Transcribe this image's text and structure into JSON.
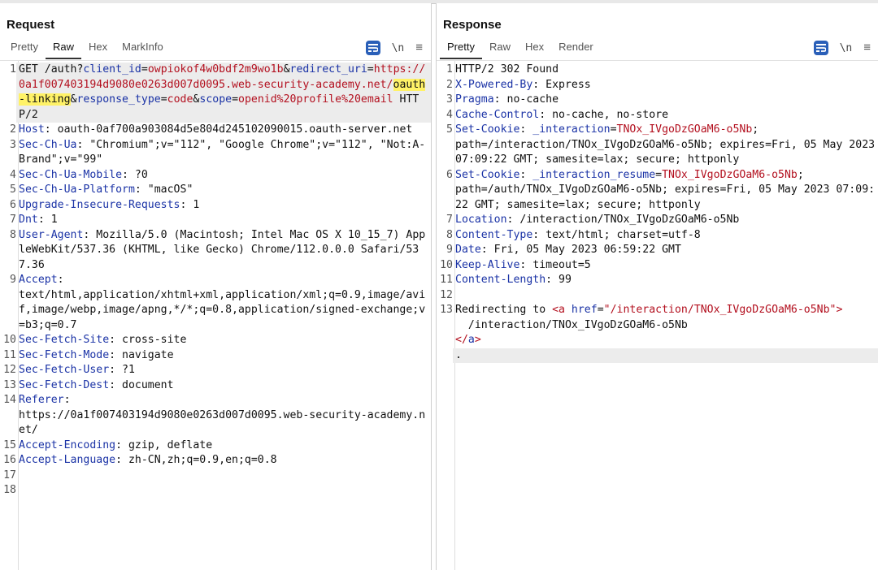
{
  "request": {
    "title": "Request",
    "tabs": [
      "Pretty",
      "Raw",
      "Hex",
      "MarkInfo"
    ],
    "active_tab": "Raw",
    "newline_toggle": "\\n",
    "lines": [
      {
        "n": "1",
        "segs": [
          [
            "t",
            "GET /auth?"
          ],
          [
            "pn",
            "client_id"
          ],
          [
            "t",
            "="
          ],
          [
            "pv",
            "owpiokof4w0bdf2m9wo1b"
          ],
          [
            "t",
            "&"
          ],
          [
            "pn",
            "redirect_uri"
          ],
          [
            "t",
            "="
          ],
          [
            "pv",
            "https://0a1f007403194d9080e0263d007d0095.web-security-academy.net/"
          ],
          [
            "mark",
            "oauth-linking"
          ],
          [
            "t",
            "&"
          ],
          [
            "pn",
            "response_type"
          ],
          [
            "t",
            "="
          ],
          [
            "pv",
            "code"
          ],
          [
            "t",
            "&"
          ],
          [
            "pn",
            "scope"
          ],
          [
            "t",
            "="
          ],
          [
            "pv",
            "openid%20profile%20email"
          ],
          [
            "t",
            " HTTP/2"
          ]
        ],
        "hl": true
      },
      {
        "n": "2",
        "segs": [
          [
            "hk",
            "Host"
          ],
          [
            "t",
            ": oauth-0af700a903084d5e804d245102090015.oauth-server.net"
          ]
        ]
      },
      {
        "n": "3",
        "segs": [
          [
            "hk",
            "Sec-Ch-Ua"
          ],
          [
            "t",
            ": \"Chromium\";v=\"112\", \"Google Chrome\";v=\"112\", \"Not:A-Brand\";v=\"99\""
          ]
        ]
      },
      {
        "n": "4",
        "segs": [
          [
            "hk",
            "Sec-Ch-Ua-Mobile"
          ],
          [
            "t",
            ": ?0"
          ]
        ]
      },
      {
        "n": "5",
        "segs": [
          [
            "hk",
            "Sec-Ch-Ua-Platform"
          ],
          [
            "t",
            ": \"macOS\""
          ]
        ]
      },
      {
        "n": "6",
        "segs": [
          [
            "hk",
            "Upgrade-Insecure-Requests"
          ],
          [
            "t",
            ": 1"
          ]
        ]
      },
      {
        "n": "7",
        "segs": [
          [
            "hk",
            "Dnt"
          ],
          [
            "t",
            ": 1"
          ]
        ]
      },
      {
        "n": "8",
        "segs": [
          [
            "hk",
            "User-Agent"
          ],
          [
            "t",
            ": Mozilla/5.0 (Macintosh; Intel Mac OS X 10_15_7) AppleWebKit/537.36 (KHTML, like Gecko) Chrome/112.0.0.0 Safari/537.36"
          ]
        ]
      },
      {
        "n": "9",
        "segs": [
          [
            "hk",
            "Accept"
          ],
          [
            "t",
            ":\ntext/html,application/xhtml+xml,application/xml;q=0.9,image/avif,image/webp,image/apng,*/*;q=0.8,application/signed-exchange;v=b3;q=0.7"
          ]
        ]
      },
      {
        "n": "10",
        "segs": [
          [
            "hk",
            "Sec-Fetch-Site"
          ],
          [
            "t",
            ": cross-site"
          ]
        ]
      },
      {
        "n": "11",
        "segs": [
          [
            "hk",
            "Sec-Fetch-Mode"
          ],
          [
            "t",
            ": navigate"
          ]
        ]
      },
      {
        "n": "12",
        "segs": [
          [
            "hk",
            "Sec-Fetch-User"
          ],
          [
            "t",
            ": ?1"
          ]
        ]
      },
      {
        "n": "13",
        "segs": [
          [
            "hk",
            "Sec-Fetch-Dest"
          ],
          [
            "t",
            ": document"
          ]
        ]
      },
      {
        "n": "14",
        "segs": [
          [
            "hk",
            "Referer"
          ],
          [
            "t",
            ":\nhttps://0a1f007403194d9080e0263d007d0095.web-security-academy.net/"
          ]
        ]
      },
      {
        "n": "15",
        "segs": [
          [
            "hk",
            "Accept-Encoding"
          ],
          [
            "t",
            ": gzip, deflate"
          ]
        ]
      },
      {
        "n": "16",
        "segs": [
          [
            "hk",
            "Accept-Language"
          ],
          [
            "t",
            ": zh-CN,zh;q=0.9,en;q=0.8"
          ]
        ]
      },
      {
        "n": "17",
        "segs": []
      },
      {
        "n": "18",
        "segs": []
      }
    ]
  },
  "response": {
    "title": "Response",
    "tabs": [
      "Pretty",
      "Raw",
      "Hex",
      "Render"
    ],
    "active_tab": "Pretty",
    "newline_toggle": "\\n",
    "lines": [
      {
        "n": "1",
        "segs": [
          [
            "t",
            "HTTP/2 302 Found"
          ]
        ]
      },
      {
        "n": "2",
        "segs": [
          [
            "hk",
            "X-Powered-By"
          ],
          [
            "t",
            ": Express"
          ]
        ]
      },
      {
        "n": "3",
        "segs": [
          [
            "hk",
            "Pragma"
          ],
          [
            "t",
            ": no-cache"
          ]
        ]
      },
      {
        "n": "4",
        "segs": [
          [
            "hk",
            "Cache-Control"
          ],
          [
            "t",
            ": no-cache, no-store"
          ]
        ]
      },
      {
        "n": "5",
        "segs": [
          [
            "hk",
            "Set-Cookie"
          ],
          [
            "t",
            ": "
          ],
          [
            "pn",
            "_interaction"
          ],
          [
            "t",
            "="
          ],
          [
            "pv",
            "TNOx_IVgoDzGOaM6-o5Nb"
          ],
          [
            "t",
            ";\npath=/interaction/TNOx_IVgoDzGOaM6-o5Nb; expires=Fri, 05 May 2023 07:09:22 GMT; samesite=lax; secure; httponly"
          ]
        ]
      },
      {
        "n": "6",
        "segs": [
          [
            "hk",
            "Set-Cookie"
          ],
          [
            "t",
            ": "
          ],
          [
            "pn",
            "_interaction_resume"
          ],
          [
            "t",
            "="
          ],
          [
            "pv",
            "TNOx_IVgoDzGOaM6-o5Nb"
          ],
          [
            "t",
            ";\npath=/auth/TNOx_IVgoDzGOaM6-o5Nb; expires=Fri, 05 May 2023 07:09:22 GMT; samesite=lax; secure; httponly"
          ]
        ]
      },
      {
        "n": "7",
        "segs": [
          [
            "hk",
            "Location"
          ],
          [
            "t",
            ": /interaction/TNOx_IVgoDzGOaM6-o5Nb"
          ]
        ]
      },
      {
        "n": "8",
        "segs": [
          [
            "hk",
            "Content-Type"
          ],
          [
            "t",
            ": text/html; charset=utf-8"
          ]
        ]
      },
      {
        "n": "9",
        "segs": [
          [
            "hk",
            "Date"
          ],
          [
            "t",
            ": Fri, 05 May 2023 06:59:22 GMT"
          ]
        ]
      },
      {
        "n": "10",
        "segs": [
          [
            "hk",
            "Keep-Alive"
          ],
          [
            "t",
            ": timeout=5"
          ]
        ]
      },
      {
        "n": "11",
        "segs": [
          [
            "hk",
            "Content-Length"
          ],
          [
            "t",
            ": 99"
          ]
        ]
      },
      {
        "n": "12",
        "segs": []
      },
      {
        "n": "13",
        "segs": [
          [
            "t",
            "Redirecting to "
          ],
          [
            "tag",
            "<a "
          ],
          [
            "at",
            "href"
          ],
          [
            "t",
            "="
          ],
          [
            "av",
            "\"/interaction/TNOx_IVgoDzGOaM6-o5Nb\""
          ],
          [
            "tag",
            ">"
          ],
          [
            "t",
            "\n  /interaction/TNOx_IVgoDzGOaM6-o5Nb\n"
          ],
          [
            "tag",
            "</"
          ],
          [
            "at",
            "a"
          ],
          [
            "tag",
            ">"
          ]
        ]
      },
      {
        "n": "",
        "segs": [
          [
            "t",
            "."
          ]
        ],
        "hl": true
      }
    ]
  }
}
